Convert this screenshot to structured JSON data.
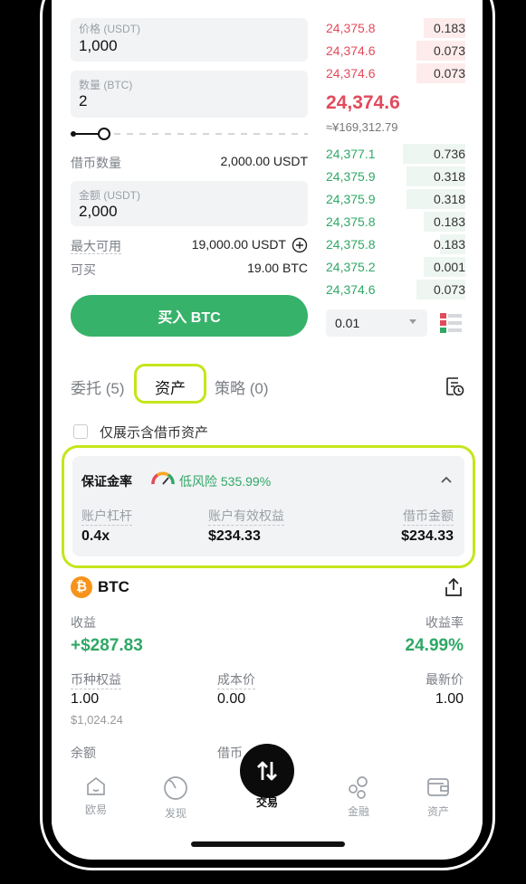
{
  "form": {
    "price_label": "价格 (USDT)",
    "price_value": "1,000",
    "qty_label": "数量 (BTC)",
    "qty_value": "2",
    "borrow_label": "借币数量",
    "borrow_value": "2,000.00 USDT",
    "amount_label": "金额 (USDT)",
    "amount_value": "2,000",
    "max_label": "最大可用",
    "max_value": "19,000.00 USDT",
    "can_buy_label": "可买",
    "can_buy_value": "19.00 BTC",
    "buy_button": "买入 BTC",
    "slider_level_percent": 10
  },
  "orderbook": {
    "asks": [
      {
        "price": "24,375.8",
        "qty": "0.183",
        "depth": 0.3
      },
      {
        "price": "24,374.6",
        "qty": "0.073",
        "depth": 0.35
      },
      {
        "price": "24,374.6",
        "qty": "0.073",
        "depth": 0.35
      }
    ],
    "mid_price": "24,374.6",
    "mid_fiat": "≈¥169,312.79",
    "bids": [
      {
        "price": "24,377.1",
        "qty": "0.736",
        "depth": 0.45
      },
      {
        "price": "24,375.9",
        "qty": "0.318",
        "depth": 0.42
      },
      {
        "price": "24,375.9",
        "qty": "0.318",
        "depth": 0.42
      },
      {
        "price": "24,375.8",
        "qty": "0.183",
        "depth": 0.3
      },
      {
        "price": "24,375.8",
        "qty": "0.183",
        "depth": 0.18
      },
      {
        "price": "24,375.2",
        "qty": "0.001",
        "depth": 0.3
      },
      {
        "price": "24,374.6",
        "qty": "0.073",
        "depth": 0.35
      }
    ],
    "depth_value": "0.01"
  },
  "tabs": [
    {
      "label": "委托 (5)"
    },
    {
      "label": "资产"
    },
    {
      "label": "策略 (0)"
    }
  ],
  "filter": {
    "label": "仅展示含借币资产"
  },
  "margin": {
    "title": "保证金率",
    "risk": "低风险 535.99%",
    "leverage_label": "账户杠杆",
    "leverage_value": "0.4x",
    "equity_label": "账户有效权益",
    "equity_value": "$234.33",
    "borrowed_label": "借币金额",
    "borrowed_value": "$234.33"
  },
  "asset": {
    "coin_symbol": "₿",
    "coin": "BTC",
    "pnl_label": "收益",
    "pnl_value": "+$287.83",
    "pnl_rate_label": "收益率",
    "pnl_rate_value": "24.99%",
    "equity_label": "币种权益",
    "equity_value": "1.00",
    "equity_fiat": "$1,024.24",
    "cost_label": "成本价",
    "cost_value": "0.00",
    "latest_label": "最新价",
    "latest_value": "1.00",
    "balance_label": "余额",
    "borrow_label": "借币"
  },
  "nav": [
    {
      "label": "欧易"
    },
    {
      "label": "发现"
    },
    {
      "label": "交易"
    },
    {
      "label": "金融"
    },
    {
      "label": "资产"
    }
  ],
  "colors": {
    "accent_green": "#37b26a",
    "ask_red": "#e34a5b",
    "highlight": "#c6e51a"
  }
}
